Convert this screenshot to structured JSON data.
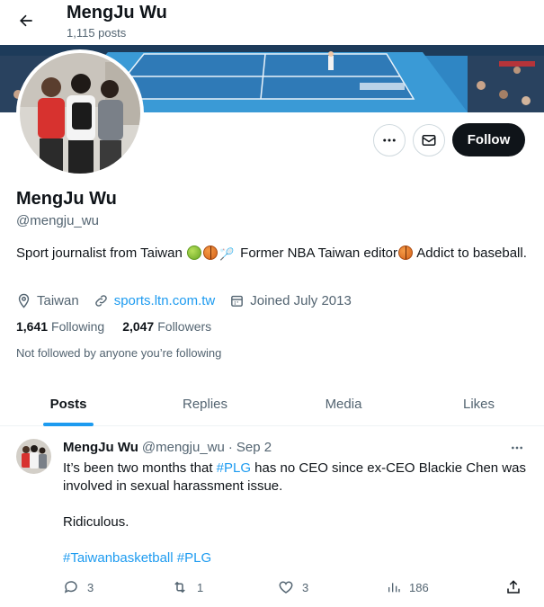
{
  "header": {
    "back_label": "Back",
    "name": "MengJu Wu",
    "post_count": "1,115 posts"
  },
  "actions": {
    "more_label": "More",
    "message_label": "Message",
    "follow_label": "Follow"
  },
  "profile": {
    "display_name": "MengJu Wu",
    "handle": "@mengju_wu",
    "bio_part1": "Sport journalist from Taiwan ",
    "bio_part2": " Former NBA Taiwan editor",
    "bio_part3": " Addict to baseball.",
    "bio_emojis": [
      "tennis-ball",
      "basketball",
      "badminton",
      "basketball"
    ],
    "location": "Taiwan",
    "website": "sports.ltn.com.tw",
    "joined": "Joined July 2013",
    "following_count": "1,641",
    "following_label": "Following",
    "followers_count": "2,047",
    "followers_label": "Followers",
    "not_followed_text": "Not followed by anyone you’re following"
  },
  "tabs": [
    {
      "label": "Posts",
      "active": true
    },
    {
      "label": "Replies",
      "active": false
    },
    {
      "label": "Media",
      "active": false
    },
    {
      "label": "Likes",
      "active": false
    }
  ],
  "tweet": {
    "name": "MengJu Wu",
    "handle": "@mengju_wu",
    "separator": "·",
    "date": "Sep 2",
    "line1_pre": "It’s been two months that ",
    "line1_hashtag": "#PLG",
    "line1_post": " has no CEO since ex-CEO Blackie Chen was involved in sexual harassment issue.",
    "line2": "Ridiculous.",
    "hashtag1": "#Taiwanbasketball",
    "hashtag2": "#PLG",
    "replies": "3",
    "reposts": "1",
    "likes": "3",
    "views": "186"
  },
  "colors": {
    "accent": "#1d9bf0",
    "text": "#0f1419",
    "secondary": "#536471",
    "border": "#cfd9de"
  }
}
